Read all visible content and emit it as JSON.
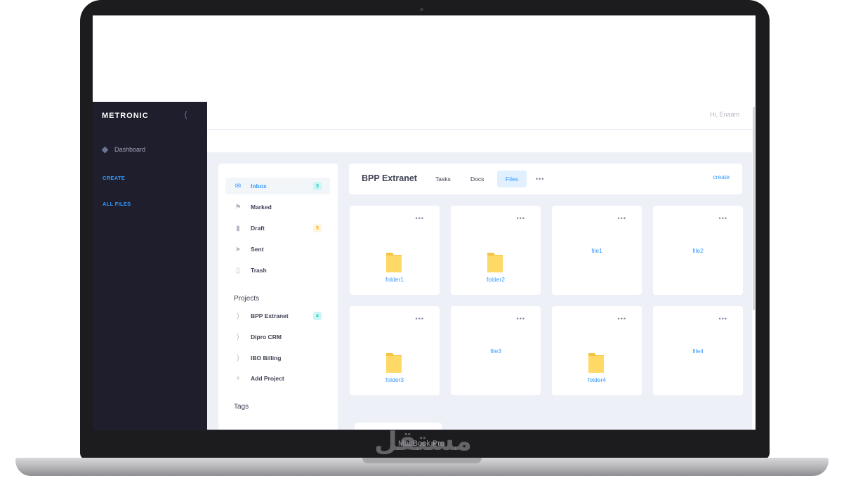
{
  "device": {
    "model_label": "MacBook Pro",
    "watermark": "مستقل"
  },
  "app": {
    "brand": "METRONIC",
    "greeting": "Hi, Enaam",
    "colors": {
      "accent": "#3699ff",
      "sidebar": "#1e1e2d",
      "folder": "#ffd966"
    }
  },
  "sidebar": {
    "dashboard": "Dashboard",
    "links": [
      "CREATE",
      "ALL FILES"
    ]
  },
  "aside": {
    "menu": [
      {
        "label": "Inbox",
        "icon": "mail-icon",
        "badge": "3",
        "active": true
      },
      {
        "label": "Marked",
        "icon": "flag-icon",
        "badge": ""
      },
      {
        "label": "Draft",
        "icon": "draft-icon",
        "badge": "5"
      },
      {
        "label": "Sent",
        "icon": "send-icon",
        "badge": ""
      },
      {
        "label": "Trash",
        "icon": "trash-icon",
        "badge": ""
      }
    ],
    "projects_title": "Projects",
    "projects": [
      {
        "label": "BPP Extranet",
        "badge": "4"
      },
      {
        "label": "Dipro CRM",
        "badge": ""
      },
      {
        "label": "IBO Billing",
        "badge": ""
      }
    ],
    "add_project": "Add Project",
    "tags_title": "Tags"
  },
  "header": {
    "title": "BPP Extranet",
    "tabs": [
      "Tasks",
      "Docs",
      "Files"
    ],
    "active_tab": "Files",
    "more": "•••",
    "create": "create"
  },
  "items": [
    {
      "name": "folder1",
      "type": "folder"
    },
    {
      "name": "folder2",
      "type": "folder"
    },
    {
      "name": "file1",
      "type": "file"
    },
    {
      "name": "file2",
      "type": "file"
    },
    {
      "name": "folder3",
      "type": "folder"
    },
    {
      "name": "file3",
      "type": "file"
    },
    {
      "name": "folder4",
      "type": "folder"
    },
    {
      "name": "file4",
      "type": "file"
    }
  ]
}
